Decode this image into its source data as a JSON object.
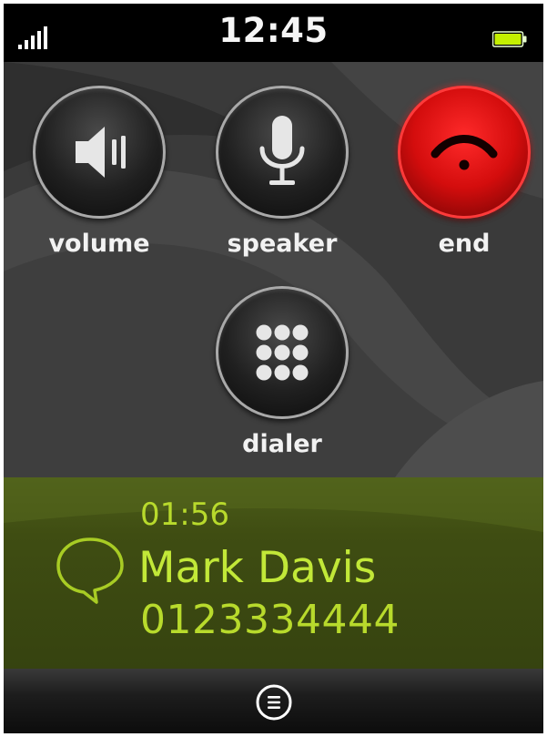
{
  "status_bar": {
    "time": "12:45",
    "signal_icon": "signal-bars-icon",
    "battery_icon": "battery-icon",
    "battery_color": "#c4f000"
  },
  "controls": {
    "volume": {
      "label": "volume",
      "icon": "volume-icon"
    },
    "speaker": {
      "label": "speaker",
      "icon": "microphone-icon"
    },
    "end": {
      "label": "end",
      "icon": "hang-up-icon",
      "color": "#e01010"
    },
    "dialer": {
      "label": "dialer",
      "icon": "keypad-icon"
    }
  },
  "call": {
    "duration": "01:56",
    "caller_name": "Mark Davis",
    "caller_number": "0123334444",
    "icon": "chat-bubble-icon",
    "accent_color": "#b8da2c"
  },
  "bottom_bar": {
    "menu_icon": "menu-icon"
  }
}
